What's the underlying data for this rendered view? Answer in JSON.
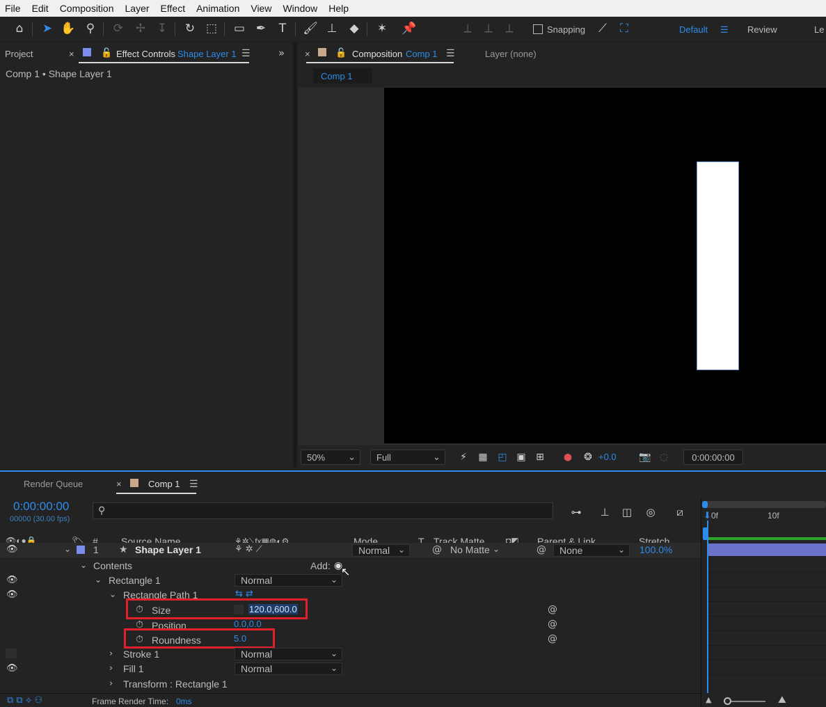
{
  "menu": [
    "File",
    "Edit",
    "Composition",
    "Layer",
    "Effect",
    "Animation",
    "View",
    "Window",
    "Help"
  ],
  "toolbar": {
    "snapping_label": "Snapping",
    "workspaces": [
      "Default",
      "Review",
      "Le"
    ]
  },
  "left_panel": {
    "project_tab": "Project",
    "effect_controls_prefix": "Effect Controls",
    "effect_controls_layer": "Shape Layer 1",
    "breadcrumb": "Comp 1 • Shape Layer 1"
  },
  "comp_panel": {
    "tab_prefix": "Composition",
    "tab_comp": "Comp 1",
    "layer_tab": "Layer (none)",
    "subtab": "Comp 1",
    "zoom": "50%",
    "resolution": "Full",
    "exposure": "+0.0",
    "timecode": "0:00:00:00"
  },
  "timeline": {
    "render_queue_tab": "Render Queue",
    "comp_tab": "Comp 1",
    "current_time": "0:00:00:00",
    "frame_info": "00000 (30.00 fps)",
    "search_placeholder": "",
    "columns": {
      "hash": "#",
      "source_name": "Source Name",
      "mode": "Mode",
      "t": "T",
      "track_matte": "Track Matte",
      "parent": "Parent & Link",
      "stretch": "Stretch"
    },
    "ruler": {
      "start": "0f",
      "mark": "10f"
    },
    "layer": {
      "number": "1",
      "name": "Shape Layer 1",
      "mode": "Normal",
      "track_matte": "No Matte",
      "parent": "None",
      "stretch": "100.0%"
    },
    "contents_label": "Contents",
    "add_label": "Add:",
    "rectangle": {
      "name": "Rectangle 1",
      "mode": "Normal"
    },
    "rect_path": {
      "name": "Rectangle Path 1"
    },
    "size": {
      "label": "Size",
      "value": "120.0,600.0"
    },
    "position": {
      "label": "Position",
      "value": "0.0,0.0"
    },
    "roundness": {
      "label": "Roundness",
      "value": "5.0"
    },
    "stroke": {
      "name": "Stroke 1",
      "mode": "Normal"
    },
    "fill": {
      "name": "Fill 1",
      "mode": "Normal"
    },
    "transform": {
      "name": "Transform : Rectangle 1"
    },
    "footer": {
      "label": "Frame Render Time:",
      "value": "0ms"
    }
  },
  "colors": {
    "accent": "#2d8ceb",
    "highlight_box": "#e0202a",
    "layer_label": "#7b8ef0",
    "comp_swatch": "#c9a98a"
  }
}
